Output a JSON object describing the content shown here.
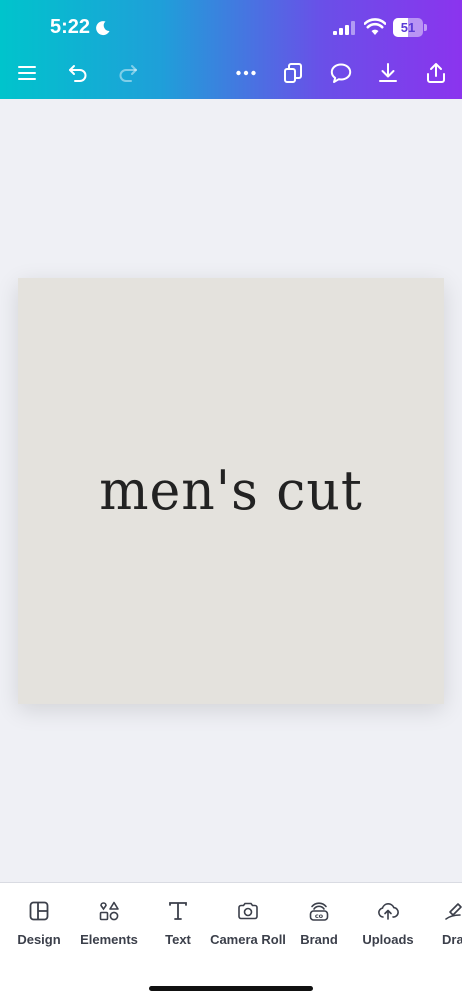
{
  "status_bar": {
    "time": "5:22",
    "battery_level": "51",
    "battery_fraction": 0.51,
    "icons": [
      "moon-icon",
      "signal-icon",
      "wifi-icon",
      "battery-icon"
    ]
  },
  "toolbar": {
    "icons": [
      "menu-icon",
      "undo-icon",
      "redo-icon",
      "more-icon",
      "pages-icon",
      "comment-icon",
      "download-icon",
      "share-icon"
    ]
  },
  "canvas": {
    "design_text": "men's cut",
    "background_color": "#e4e2dd"
  },
  "bottom_nav": {
    "items": [
      {
        "label": "Design",
        "icon": "design-icon"
      },
      {
        "label": "Elements",
        "icon": "elements-icon"
      },
      {
        "label": "Text",
        "icon": "text-icon"
      },
      {
        "label": "Camera Roll",
        "icon": "camera-icon"
      },
      {
        "label": "Brand",
        "icon": "brand-icon"
      },
      {
        "label": "Uploads",
        "icon": "uploads-icon"
      },
      {
        "label": "Dra",
        "icon": "draw-icon"
      }
    ]
  },
  "colors": {
    "gradient_start": "#00c4cc",
    "gradient_end": "#8b34ee",
    "canvas_bg": "#eff0f5"
  }
}
